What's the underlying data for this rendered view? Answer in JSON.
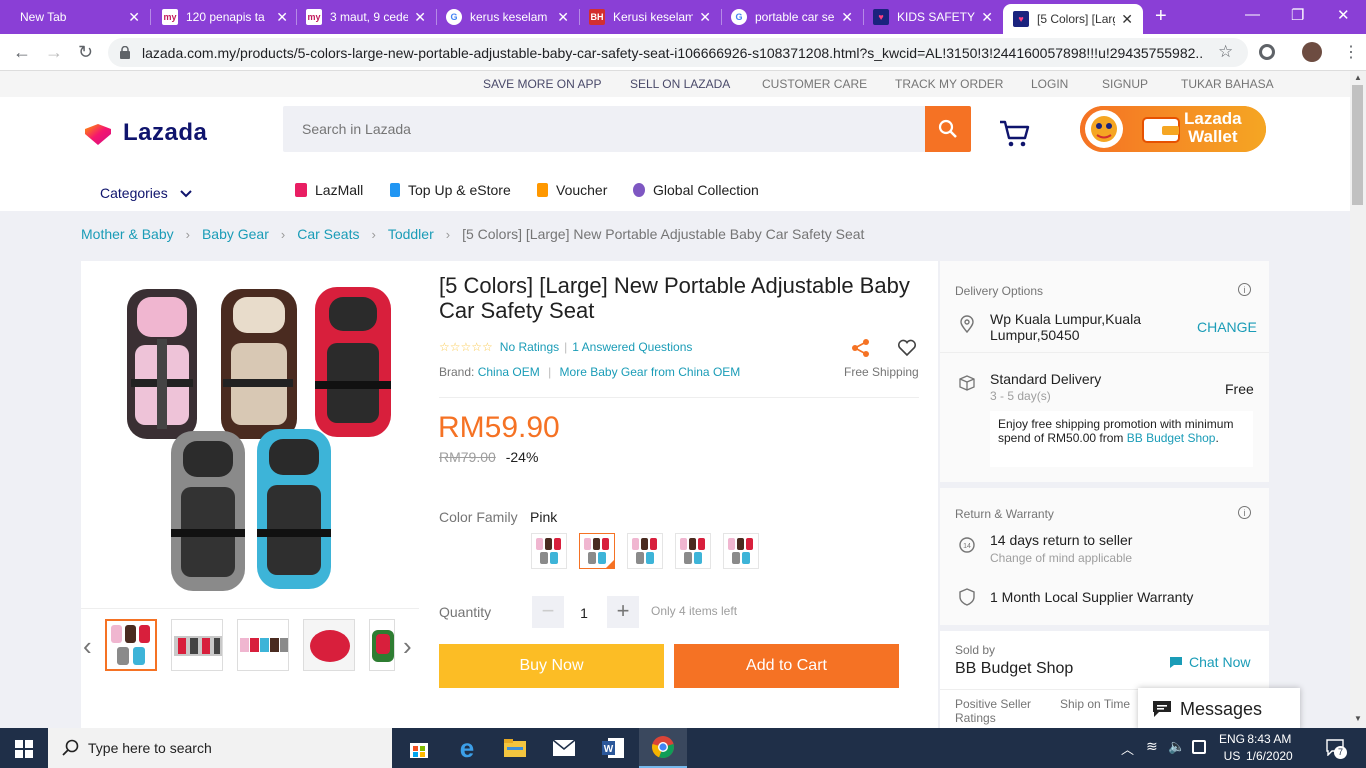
{
  "browser": {
    "tabs": [
      {
        "title": "New Tab",
        "favicon": "none"
      },
      {
        "title": "120 penapis ta",
        "favicon": "my"
      },
      {
        "title": "3 maut, 9 cede",
        "favicon": "my"
      },
      {
        "title": "kerus keselam",
        "favicon": "G"
      },
      {
        "title": "Kerusi keselam",
        "favicon": "BH"
      },
      {
        "title": "portable car se",
        "favicon": "G"
      },
      {
        "title": "KIDS SAFETY T",
        "favicon": "lazada"
      },
      {
        "title": "[5 Colors] [Larg",
        "favicon": "lazada"
      }
    ],
    "url": "lazada.com.my/products/5-colors-large-new-portable-adjustable-baby-car-safety-seat-i106666926-s108371208.html?s_kwcid=AL!3150!3!244160057898!!!u!29435755982..."
  },
  "toplinks": [
    "SAVE MORE ON APP",
    "SELL ON LAZADA",
    "CUSTOMER CARE",
    "TRACK MY ORDER",
    "LOGIN",
    "SIGNUP",
    "TUKAR BAHASA"
  ],
  "header": {
    "logo": "Lazada",
    "search_placeholder": "Search in Lazada",
    "wallet_line1": "Lazada",
    "wallet_line2": "Wallet",
    "categories": "Categories",
    "nav": [
      "LazMall",
      "Top Up & eStore",
      "Voucher",
      "Global Collection"
    ]
  },
  "breadcrumb": [
    "Mother & Baby",
    "Baby Gear",
    "Car Seats",
    "Toddler"
  ],
  "breadcrumb_current": "[5 Colors] [Large] New Portable Adjustable Baby Car Safety Seat",
  "product": {
    "title": "[5 Colors] [Large] New Portable Adjustable Baby Car Safety Seat",
    "ratings": "No Ratings",
    "questions": "1 Answered Questions",
    "brand_label": "Brand:",
    "brand": "China OEM",
    "more": "More Baby Gear from China OEM",
    "free_shipping": "Free Shipping",
    "price": "RM59.90",
    "original_price": "RM79.00",
    "discount": "-24%",
    "color_label": "Color Family",
    "color_value": "Pink",
    "qty_label": "Quantity",
    "qty": "1",
    "stock": "Only 4 items left",
    "buy_now": "Buy Now",
    "add_to_cart": "Add to Cart"
  },
  "delivery": {
    "heading": "Delivery Options",
    "location": "Wp Kuala Lumpur,Kuala Lumpur,50450",
    "change": "CHANGE",
    "standard": "Standard Delivery",
    "days": "3 - 5 day(s)",
    "cost": "Free",
    "promo_prefix": "Enjoy free shipping promotion with minimum spend of RM50.00 from ",
    "promo_shop": "BB Budget Shop",
    "promo_suffix": "."
  },
  "warranty": {
    "heading": "Return & Warranty",
    "return": "14 days return to seller",
    "return_sub": "Change of mind applicable",
    "warranty": "1 Month Local Supplier Warranty"
  },
  "seller": {
    "label": "Sold by",
    "name": "BB Budget Shop",
    "chat": "Chat Now",
    "col1": "Positive Seller Ratings",
    "col2": "Ship on Time"
  },
  "messages": "Messages",
  "taskbar": {
    "search": "Type here to search",
    "lang1": "ENG",
    "lang2": "US",
    "time": "8:43 AM",
    "date": "1/6/2020",
    "notifications": "7"
  },
  "colors": {
    "accent": "#f57224",
    "link": "#1a9cb7",
    "buy": "#fcbd25",
    "tabstrip": "#8a3fd6"
  }
}
